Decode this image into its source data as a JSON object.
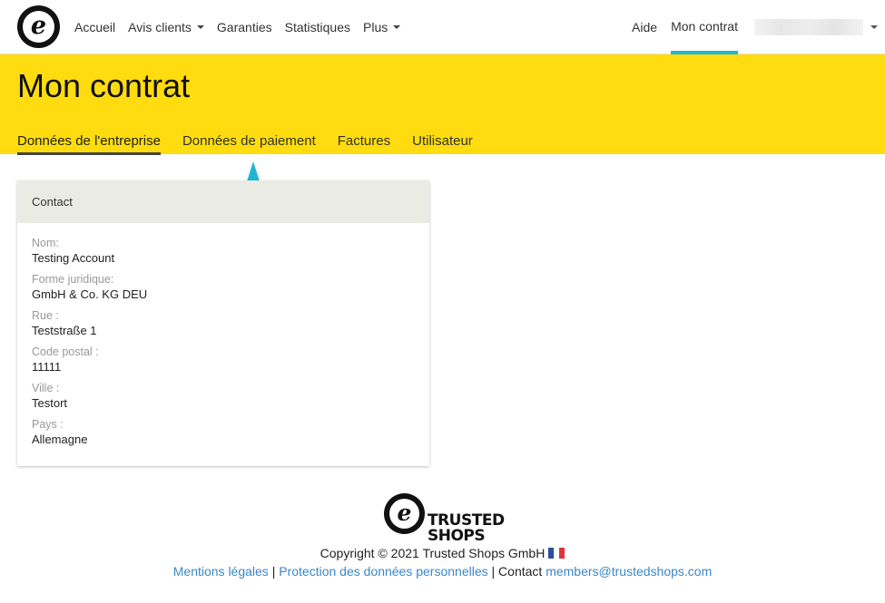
{
  "nav": {
    "logo_glyph": "e",
    "left_items": [
      {
        "label": "Accueil",
        "has_caret": false
      },
      {
        "label": "Avis clients",
        "has_caret": true
      },
      {
        "label": "Garanties",
        "has_caret": false
      },
      {
        "label": "Statistiques",
        "has_caret": false
      },
      {
        "label": "Plus",
        "has_caret": true
      }
    ],
    "help_label": "Aide",
    "contract_label": "Mon contrat",
    "accent_color": "#1fb6d5"
  },
  "header": {
    "title": "Mon contrat",
    "background_color": "#ffdc0f",
    "tabs": [
      {
        "label": "Données de l'entreprise",
        "active": true
      },
      {
        "label": "Données de paiement",
        "active": false
      },
      {
        "label": "Factures",
        "active": false
      },
      {
        "label": "Utilisateur",
        "active": false
      }
    ]
  },
  "annotation": {
    "icon": "arrow-up-icon",
    "color": "#1fb6d5"
  },
  "card": {
    "title": "Contact",
    "fields": [
      {
        "label": "Nom:",
        "value": "Testing Account"
      },
      {
        "label": "Forme juridique:",
        "value": "GmbH & Co. KG DEU"
      },
      {
        "label": "Rue :",
        "value": "Teststraße 1"
      },
      {
        "label": "Code postal :",
        "value": "11111"
      },
      {
        "label": "Ville :",
        "value": "Testort"
      },
      {
        "label": "Pays :",
        "value": "Allemagne"
      }
    ]
  },
  "footer": {
    "logo_glyph": "e",
    "logo_word_1": "TRUSTED",
    "logo_word_2": "SHOPS",
    "copyright": "Copyright © 2021 Trusted Shops GmbH",
    "flag_icon": "france-flag-icon",
    "link_legal": "Mentions légales",
    "sep_1": " | ",
    "link_privacy": "Protection des données personnelles",
    "sep_2": " | ",
    "contact_label": "Contact",
    "contact_email": "members@trustedshops.com",
    "link_color": "#3a86c8"
  }
}
